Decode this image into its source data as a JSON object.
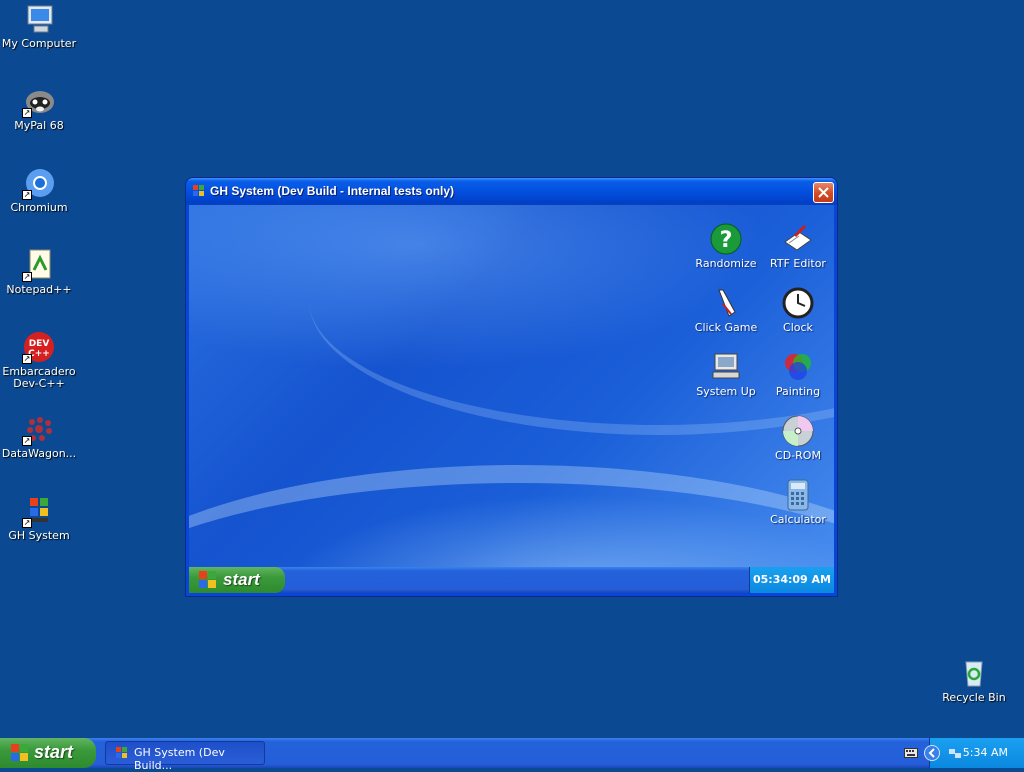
{
  "desktop": {
    "icons": [
      {
        "label": "My Computer"
      },
      {
        "label": "MyPal 68"
      },
      {
        "label": "Chromium"
      },
      {
        "label": "Notepad++"
      },
      {
        "label": "Embarcadero\nDev-C++"
      },
      {
        "label": "DataWagon..."
      },
      {
        "label": "GH System"
      },
      {
        "label": "Recycle Bin"
      }
    ]
  },
  "window": {
    "title": "GH System (Dev Build - Internal tests only)",
    "apps": [
      {
        "label": "Randomize",
        "icon": "question-icon"
      },
      {
        "label": "RTF Editor",
        "icon": "notepad-icon"
      },
      {
        "label": "Click Game",
        "icon": "pointer-icon"
      },
      {
        "label": "Clock",
        "icon": "clock-icon"
      },
      {
        "label": "System Up",
        "icon": "computer-icon"
      },
      {
        "label": "Painting",
        "icon": "color-circles-icon"
      },
      {
        "label": "CD-ROM",
        "icon": "cd-icon"
      },
      {
        "label": "Calculator",
        "icon": "calculator-icon"
      }
    ],
    "inner_start_label": "start",
    "inner_clock": "05:34:09 AM"
  },
  "taskbar": {
    "start_label": "start",
    "task_item_label": "GH System (Dev Build...",
    "clock": "5:34 AM"
  }
}
